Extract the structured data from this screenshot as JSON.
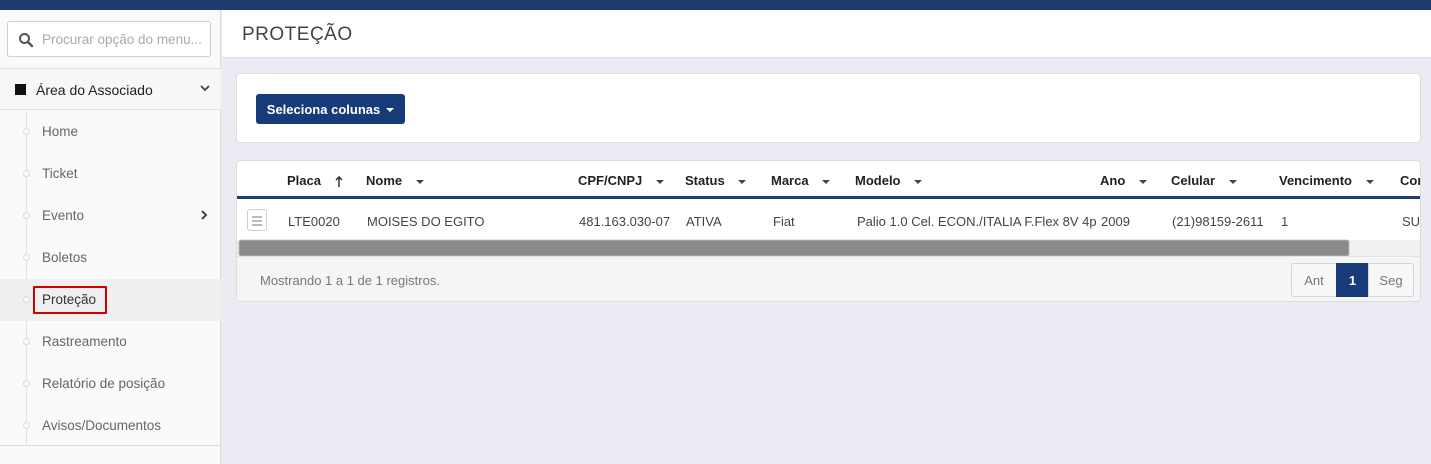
{
  "search": {
    "placeholder": "Procurar opção do menu..."
  },
  "sidebar": {
    "section_label": "Área do Associado",
    "items": [
      {
        "label": "Home"
      },
      {
        "label": "Ticket"
      },
      {
        "label": "Evento"
      },
      {
        "label": "Boletos"
      },
      {
        "label": "Proteção"
      },
      {
        "label": "Rastreamento"
      },
      {
        "label": "Relatório de posição"
      },
      {
        "label": "Avisos/Documentos"
      }
    ],
    "active_item": "Proteção"
  },
  "header": {
    "title": "PROTEÇÃO"
  },
  "toolbar": {
    "columns_button": "Seleciona colunas"
  },
  "table": {
    "columns": [
      "Placa",
      "Nome",
      "CPF/CNPJ",
      "Status",
      "Marca",
      "Modelo",
      "Ano",
      "Celular",
      "Vencimento",
      "Cor"
    ],
    "sorted_column": "Placa",
    "rows": [
      [
        "LTE0020",
        "MOISES DO EGITO",
        "481.163.030-07",
        "ATIVA",
        "Fiat",
        "Palio 1.0 Cel. ECON./ITALIA F.Flex 8V 4p",
        "2009",
        "(21)98159-2611",
        "1",
        "SUI"
      ]
    ]
  },
  "footer": {
    "info": "Mostrando 1 a 1 de 1 registros.",
    "prev": "Ant",
    "current": "1",
    "next": "Seg"
  },
  "colors": {
    "brand": "#173a78",
    "topbar": "#1f3a6e",
    "highlight": "#d40000"
  }
}
